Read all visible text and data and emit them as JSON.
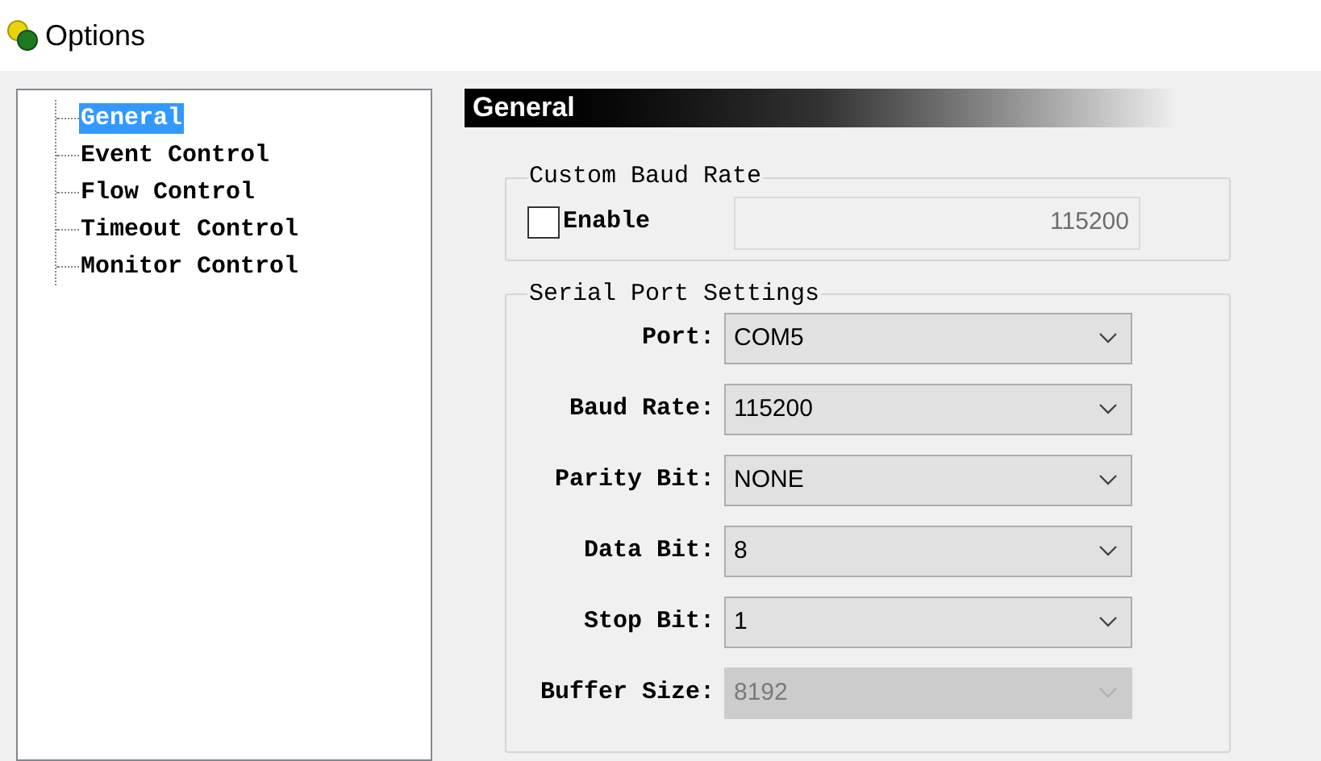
{
  "window": {
    "title": "Options"
  },
  "tree": {
    "items": [
      {
        "label": "General",
        "selected": true
      },
      {
        "label": "Event Control",
        "selected": false
      },
      {
        "label": "Flow Control",
        "selected": false
      },
      {
        "label": "Timeout Control",
        "selected": false
      },
      {
        "label": "Monitor Control",
        "selected": false
      }
    ]
  },
  "page_header": "General",
  "custom_baud_rate": {
    "title": "Custom Baud Rate",
    "enable": {
      "label": "Enable",
      "checked": false
    },
    "rate": {
      "value": "115200",
      "disabled": true
    }
  },
  "serial_port_settings": {
    "title": "Serial Port Settings",
    "fields": [
      {
        "label": "Port:",
        "value": "COM5",
        "disabled": false
      },
      {
        "label": "Baud Rate:",
        "value": "115200",
        "disabled": false
      },
      {
        "label": "Parity Bit:",
        "value": "NONE",
        "disabled": false
      },
      {
        "label": "Data Bit:",
        "value": "8",
        "disabled": false
      },
      {
        "label": "Stop Bit:",
        "value": "1",
        "disabled": false
      },
      {
        "label": "Buffer Size:",
        "value": "8192",
        "disabled": true
      }
    ]
  }
}
